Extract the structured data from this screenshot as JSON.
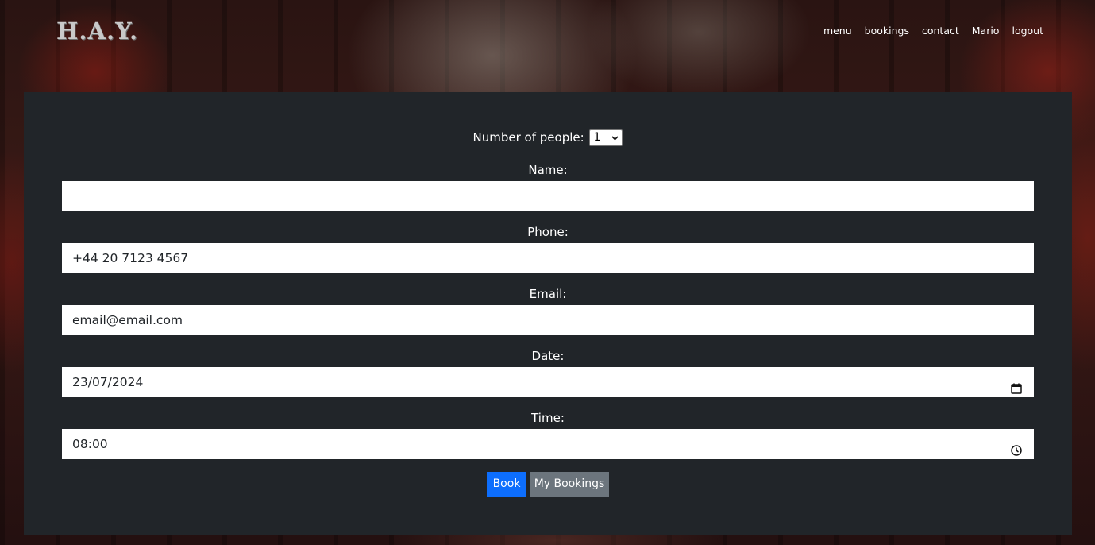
{
  "nav": {
    "brand": "H.A.Y.",
    "links": [
      "menu",
      "bookings",
      "contact",
      "Mario",
      "logout"
    ]
  },
  "form": {
    "people_label": "Number of people:",
    "people_value": "1",
    "name_label": "Name:",
    "name_value": "",
    "phone_label": "Phone:",
    "phone_value": "+44 20 7123 4567",
    "email_label": "Email:",
    "email_value": "email@email.com",
    "date_label": "Date:",
    "date_value": "23/07/2024",
    "time_label": "Time:",
    "time_value": "08:00",
    "book_label": "Book",
    "mybookings_label": "My Bookings"
  },
  "icons": {
    "date_picker": "calendar-icon",
    "time_picker": "clock-icon",
    "select_arrow": "chevron-down-icon"
  },
  "colors": {
    "panel": "#212529",
    "book_button": "#0d6efd",
    "mybookings_button": "#6c757d"
  }
}
